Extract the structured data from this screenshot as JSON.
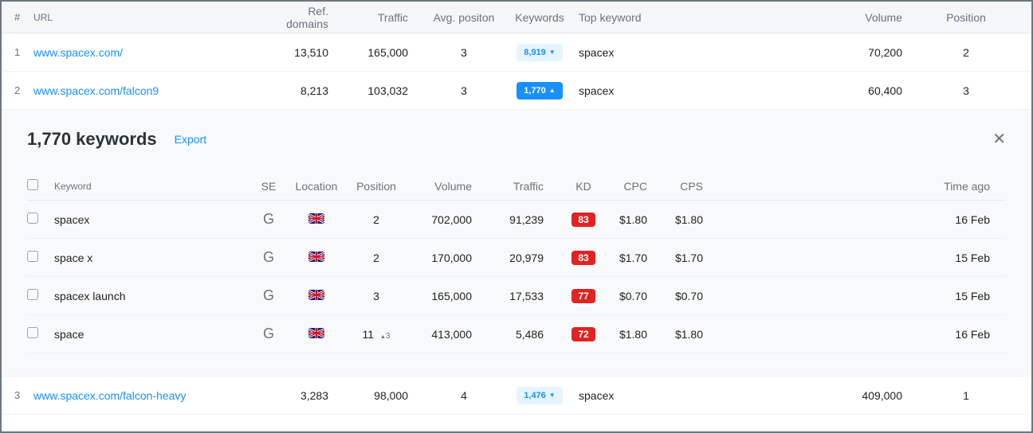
{
  "headers": {
    "num": "#",
    "url": "URL",
    "ref": "Ref. domains",
    "traffic": "Traffic",
    "avgpos": "Avg. positon",
    "keywords": "Keywords",
    "topkw": "Top keyword",
    "volume": "Volume",
    "position": "Position"
  },
  "rows": [
    {
      "n": "1",
      "url": "www.spacex.com/",
      "ref": "13,510",
      "traffic": "165,000",
      "avg": "3",
      "kw": "8,919",
      "kwstyle": "light",
      "caret": "▼",
      "top": "spacex",
      "vol": "70,200",
      "pos": "2"
    },
    {
      "n": "2",
      "url": "www.spacex.com/falcon9",
      "ref": "8,213",
      "traffic": "103,032",
      "avg": "3",
      "kw": "1,770",
      "kwstyle": "solid",
      "caret": "▲",
      "top": "spacex",
      "vol": "60,400",
      "pos": "3"
    },
    {
      "n": "3",
      "url": "www.spacex.com/falcon-heavy",
      "ref": "3,283",
      "traffic": "98,000",
      "avg": "4",
      "kw": "1,476",
      "kwstyle": "light",
      "caret": "▼",
      "top": "spacex",
      "vol": "409,000",
      "pos": "1"
    }
  ],
  "panel": {
    "title": "1,770 keywords",
    "export": "Export",
    "headers": {
      "kw": "Keyword",
      "se": "SE",
      "loc": "Location",
      "pos": "Position",
      "vol": "Volume",
      "traffic": "Traffic",
      "kd": "KD",
      "cpc": "CPC",
      "cps": "CPS",
      "time": "Time ago"
    },
    "rows": [
      {
        "kw": "spacex",
        "se": "G",
        "loc": "uk",
        "pos": "2",
        "poschange": "",
        "vol": "702,000",
        "traffic": "91,239",
        "kd": "83",
        "cpc": "$1.80",
        "cps": "$1.80",
        "time": "16 Feb"
      },
      {
        "kw": "space x",
        "se": "G",
        "loc": "uk",
        "pos": "2",
        "poschange": "",
        "vol": "170,000",
        "traffic": "20,979",
        "kd": "83",
        "cpc": "$1.70",
        "cps": "$1.70",
        "time": "15 Feb"
      },
      {
        "kw": "spacex launch",
        "se": "G",
        "loc": "uk",
        "pos": "3",
        "poschange": "",
        "vol": "165,000",
        "traffic": "17,533",
        "kd": "77",
        "cpc": "$0.70",
        "cps": "$0.70",
        "time": "15 Feb"
      },
      {
        "kw": "space",
        "se": "G",
        "loc": "uk",
        "pos": "11",
        "poschange": "3",
        "vol": "413,000",
        "traffic": "5,486",
        "kd": "72",
        "cpc": "$1.80",
        "cps": "$1.80",
        "time": "16 Feb"
      }
    ]
  }
}
